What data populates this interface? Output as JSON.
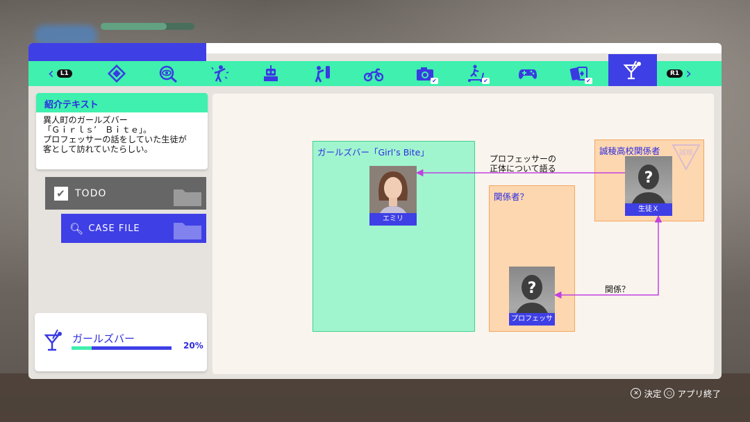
{
  "colors": {
    "accent_blue": "#3f3fe6",
    "accent_green": "#3ff0ae",
    "link_purple": "#c040e0",
    "group_green": "#a0f5cf",
    "group_orange": "#fdd7b0"
  },
  "tabbar": {
    "left_button": "L1",
    "right_button": "R1",
    "tabs": [
      {
        "icon": "diamond-icon"
      },
      {
        "icon": "eye-magnifier-icon"
      },
      {
        "icon": "dancer-icon"
      },
      {
        "icon": "robot-icon"
      },
      {
        "icon": "boxer-icon"
      },
      {
        "icon": "motorcycle-icon"
      },
      {
        "icon": "camera-icon",
        "checked": true
      },
      {
        "icon": "scooter-icon",
        "checked": true
      },
      {
        "icon": "gamepad-icon"
      },
      {
        "icon": "cards-icon",
        "checked": true
      },
      {
        "icon": "cocktail-icon",
        "active": true
      }
    ]
  },
  "intro": {
    "title": "紹介テキスト",
    "body": "異人町のガールズバー\n「Ｇｉｒｌｓ’　Ｂｉｔｅ」。\nプロフェッサーの話をしていた生徒が\n客として訪れていたらしい。"
  },
  "menu": {
    "todo_label": "TODO",
    "case_file_label": "CASE FILE"
  },
  "progress": {
    "name": "ガールズバー",
    "percent_text": "20%",
    "fraction": 0.2
  },
  "chart": {
    "groups": {
      "girls_bar": "ガールズバー「Girl’s Bite」",
      "related": "関係者？",
      "school": "誠稜高校関係者"
    },
    "school_seal": "誠稜",
    "characters": {
      "emiri": "エミリ",
      "professor": "プロフェッサー",
      "student_x": "生徒Ｘ"
    },
    "links": {
      "x_to_emiri": "プロフェッサーの\n正体について語る",
      "x_to_professor": "関係？"
    }
  },
  "footer": {
    "confirm": "決定",
    "quit": "アプリ終了"
  }
}
